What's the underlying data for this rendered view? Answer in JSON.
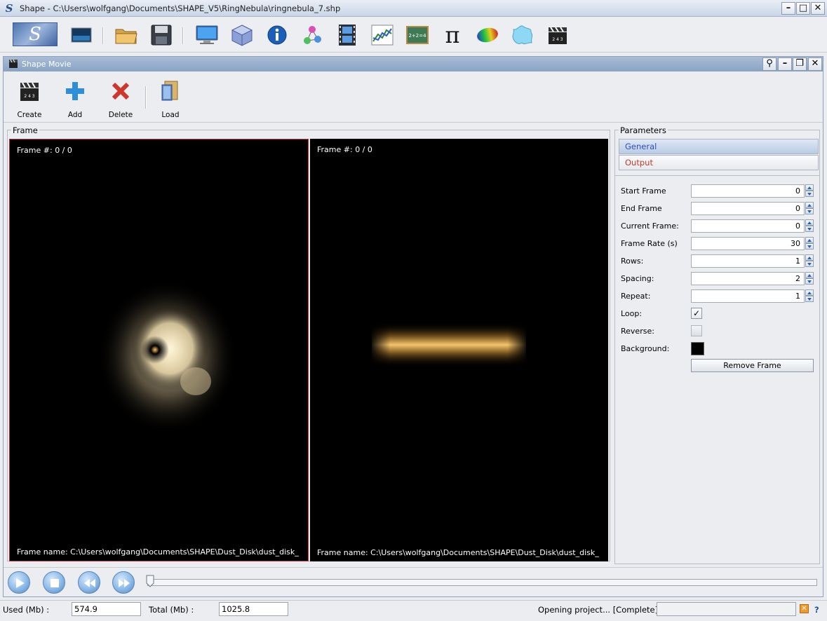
{
  "window": {
    "title": "Shape - C:\\Users\\wolfgang\\Documents\\SHAPE_V5\\RingNebula\\ringnebula_7.shp",
    "app_icon": "S"
  },
  "main_toolbar": {
    "icons": [
      "shape-logo-icon",
      "render-view-icon",
      "open-folder-icon",
      "save-disk-icon",
      "monitor-icon",
      "cube-icon",
      "info-icon",
      "node-graph-icon",
      "film-strip-icon",
      "plot-chart-icon",
      "chalkboard-icon",
      "pi-icon",
      "color-ellipse-icon",
      "splash-icon",
      "clapperboard-icon"
    ],
    "chalkboard_text": "2+2=4",
    "pi_glyph": "π"
  },
  "inner_window": {
    "title": "Shape Movie",
    "pin": "⚲",
    "minimize": "–",
    "restore": "❐",
    "close": "✕"
  },
  "sub_toolbar": {
    "create_label": "Create",
    "add_label": "Add",
    "delete_label": "Delete",
    "load_label": "Load",
    "clap_digits": "2 4 3"
  },
  "frame_panel": {
    "title": "Frame",
    "left_view": {
      "frame_number": "Frame #: 0 / 0",
      "frame_name": "Frame name: C:\\Users\\wolfgang\\Documents\\SHAPE\\Dust_Disk\\dust_disk_"
    },
    "right_view": {
      "frame_number": "Frame #: 0 / 0",
      "frame_name": "Frame name: C:\\Users\\wolfgang\\Documents\\SHAPE\\Dust_Disk\\dust_disk_"
    }
  },
  "parameters": {
    "title": "Parameters",
    "tabs": [
      {
        "label": "General",
        "color": "#2a4fc4"
      },
      {
        "label": "Output",
        "color": "#c43a2a"
      }
    ],
    "fields": {
      "start_frame": {
        "label": "Start Frame",
        "value": "0"
      },
      "end_frame": {
        "label": "End Frame",
        "value": "0"
      },
      "current_frame": {
        "label": "Current Frame:",
        "value": "0"
      },
      "frame_rate": {
        "label": "Frame Rate (s)",
        "value": "30"
      },
      "rows": {
        "label": "Rows:",
        "value": "1"
      },
      "spacing": {
        "label": "Spacing:",
        "value": "2"
      },
      "repeat": {
        "label": "Repeat:",
        "value": "1"
      }
    },
    "loop": {
      "label": "Loop:",
      "checked": true,
      "mark": "✓"
    },
    "reverse": {
      "label": "Reverse:",
      "checked": false
    },
    "background": {
      "label": "Background:",
      "color": "#000000"
    },
    "remove_frame_label": "Remove Frame"
  },
  "playback": {
    "position": 0
  },
  "status": {
    "used_label": "Used (Mb) :",
    "used_value": "574.9",
    "total_label": "Total (Mb) :",
    "total_value": "1025.8",
    "message": "Opening project... [Complete]",
    "help": "?"
  }
}
